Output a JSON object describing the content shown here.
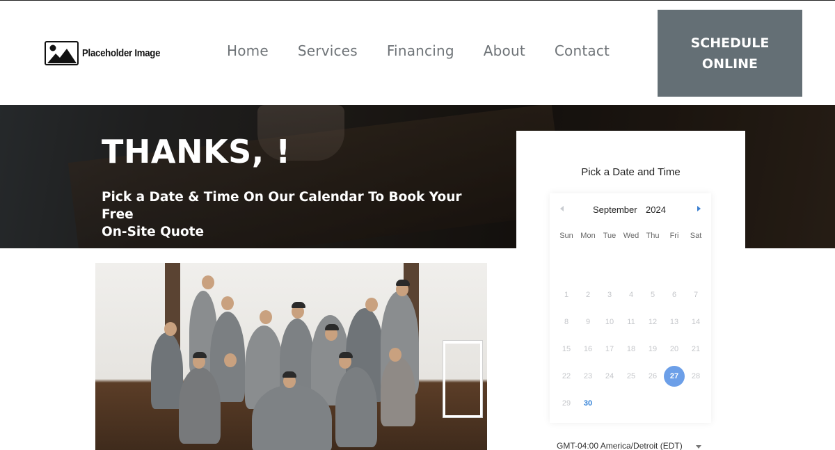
{
  "header": {
    "logo_text": "Placeholder Image",
    "nav": [
      "Home",
      "Services",
      "Financing",
      "About",
      "Contact"
    ],
    "cta_line1": "SCHEDULE",
    "cta_line2": "ONLINE"
  },
  "hero": {
    "title": "THANKS, !",
    "subtitle_line1": "Pick a Date & Time On Our Calendar To Book Your Free",
    "subtitle_line2": "On-Site Quote"
  },
  "scheduler": {
    "title": "Pick a Date and Time",
    "month": "September",
    "year": "2024",
    "weekdays": [
      "Sun",
      "Mon",
      "Tue",
      "Wed",
      "Thu",
      "Fri",
      "Sat"
    ],
    "weeks": [
      [
        "1",
        "2",
        "3",
        "4",
        "5",
        "6",
        "7"
      ],
      [
        "8",
        "9",
        "10",
        "11",
        "12",
        "13",
        "14"
      ],
      [
        "15",
        "16",
        "17",
        "18",
        "19",
        "20",
        "21"
      ],
      [
        "22",
        "23",
        "24",
        "25",
        "26",
        "27",
        "28"
      ],
      [
        "29",
        "30"
      ]
    ],
    "selected_day": "27",
    "available_days": [
      "30"
    ],
    "timezone": "GMT-04:00 America/Detroit (EDT)"
  },
  "colors": {
    "cta_bg": "#646f75",
    "nav_text": "#6e7377",
    "selected_day_bg": "#6c9fe8",
    "available_day": "#2f7fd6"
  }
}
